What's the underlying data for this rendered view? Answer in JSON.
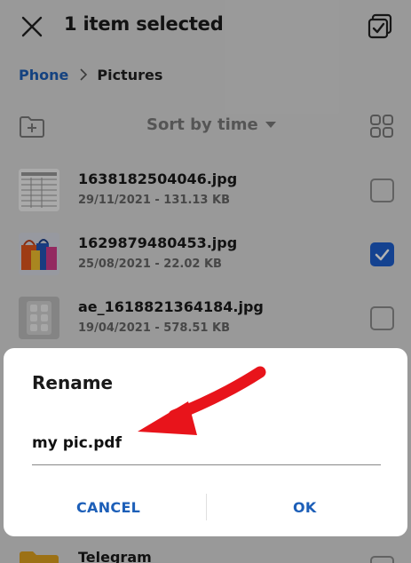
{
  "header": {
    "title": "1 item selected",
    "close_icon": "close-icon",
    "select_all_icon": "select-all-icon"
  },
  "breadcrumb": {
    "items": [
      "Phone",
      "Pictures"
    ]
  },
  "toolbar": {
    "sort_label": "Sort by time",
    "new_folder_icon": "new-folder-icon",
    "view_icon": "grid-view-icon"
  },
  "files": [
    {
      "name": "1638182504046.jpg",
      "meta": "29/11/2021 - 131.13 KB",
      "checked": false
    },
    {
      "name": "1629879480453.jpg",
      "meta": "25/08/2021 - 22.02 KB",
      "checked": true
    },
    {
      "name": "ae_1618821364184.jpg",
      "meta": "19/04/2021 - 578.51 KB",
      "checked": false
    }
  ],
  "bottom_item": {
    "name": "Telegram"
  },
  "dialog": {
    "title": "Rename",
    "value": "my pic.pdf",
    "cancel_label": "CANCEL",
    "ok_label": "OK"
  },
  "colors": {
    "accent": "#1d5fb8",
    "checkbox_checked": "#1d5fcf",
    "annotation_arrow": "#e8141b"
  }
}
